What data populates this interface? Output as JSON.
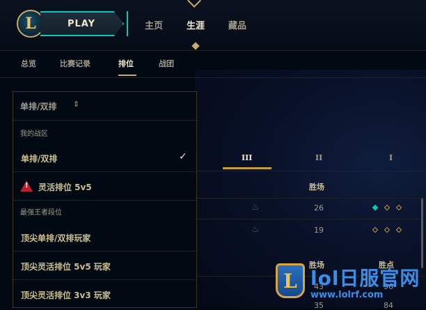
{
  "header": {
    "logo_letter": "L",
    "play_label": "PLAY",
    "nav": [
      "主页",
      "生涯",
      "藏品"
    ],
    "active_nav": 1
  },
  "subnav": {
    "items": [
      "总览",
      "比赛记录",
      "排位",
      "战团"
    ],
    "active": 2
  },
  "ranked": {
    "tiers": [
      "III",
      "II",
      "I"
    ],
    "active_tier": 0,
    "col_wins": "胜场",
    "col_wins_2": "胜场",
    "col_lp": "胜点",
    "rows": [
      {
        "wins": "26",
        "pips_filled": 1
      },
      {
        "wins": "19",
        "pips_filled": 0
      }
    ],
    "lower_rows": [
      {
        "wins": "43",
        "lp": "96"
      },
      {
        "wins": "35",
        "lp": "84"
      }
    ]
  },
  "dropdown": {
    "header_label": "单排/双排",
    "section_my": "我的战区",
    "selected_item": "单排/双排",
    "flex_item": "灵活排位 5v5",
    "section_master": "最强王者段位",
    "items": [
      "顶尖单排/双排玩家",
      "顶尖灵活排位 5v5 玩家",
      "顶尖灵活排位 3v3 玩家"
    ]
  },
  "watermark": {
    "logo_letter": "L",
    "title": "lol日服官网",
    "url": "www.lolrf.com"
  },
  "colors": {
    "gold": "#c8aa6e",
    "teal": "#0ac8b9",
    "warning": "#c01e2a",
    "watermark_blue": "#3a8ee8"
  }
}
